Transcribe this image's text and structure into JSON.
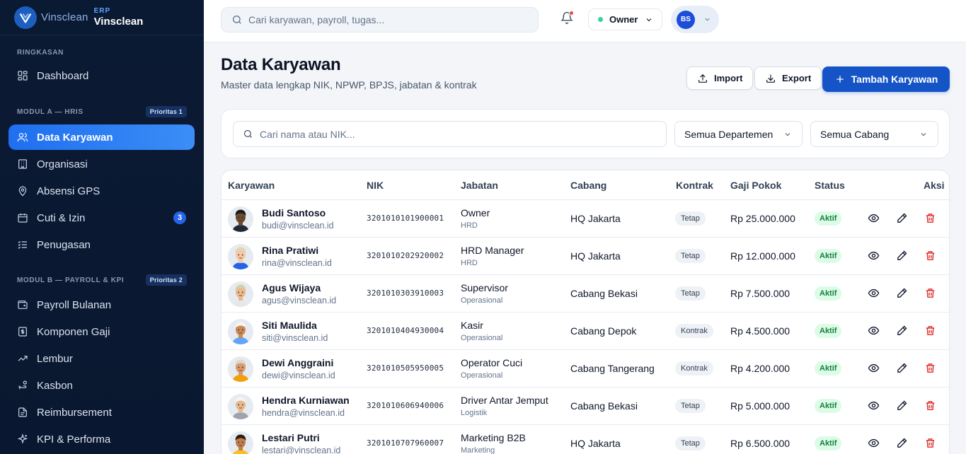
{
  "brand": {
    "logo_text": "Vinsclean",
    "erp": "ERP",
    "name": "Vinsclean"
  },
  "sidebar": {
    "sections": [
      {
        "label": "RINGKASAN",
        "badge": ""
      },
      {
        "label": "MODUL A — HRIS",
        "badge": "Prioritas 1"
      },
      {
        "label": "MODUL B — PAYROLL & KPI",
        "badge": "Prioritas 2"
      }
    ],
    "items": [
      {
        "label": "Dashboard",
        "icon": "grid-icon"
      },
      {
        "label": "Data Karyawan",
        "icon": "users-icon",
        "active": true
      },
      {
        "label": "Organisasi",
        "icon": "building-icon"
      },
      {
        "label": "Absensi GPS",
        "icon": "map-pin-icon"
      },
      {
        "label": "Cuti & Izin",
        "icon": "calendar-icon",
        "badge": "3"
      },
      {
        "label": "Penugasan",
        "icon": "list-check-icon"
      },
      {
        "label": "Payroll Bulanan",
        "icon": "wallet-icon"
      },
      {
        "label": "Komponen Gaji",
        "icon": "receipt-icon"
      },
      {
        "label": "Lembur",
        "icon": "trending-up-icon"
      },
      {
        "label": "Kasbon",
        "icon": "hand-coins-icon"
      },
      {
        "label": "Reimbursement",
        "icon": "file-text-icon"
      },
      {
        "label": "KPI & Performa",
        "icon": "sparkle-icon"
      }
    ]
  },
  "topbar": {
    "search_placeholder": "Cari karyawan, payroll, tugas...",
    "role": "Owner",
    "user_initials": "BS"
  },
  "page": {
    "title": "Data Karyawan",
    "subtitle": "Master data lengkap NIK, NPWP, BPJS, jabatan & kontrak",
    "import_label": "Import",
    "export_label": "Export",
    "add_label": "Tambah Karyawan"
  },
  "filters": {
    "search_placeholder": "Cari nama atau NIK...",
    "department": "Semua Departemen",
    "branch": "Semua Cabang"
  },
  "table": {
    "columns": [
      "Karyawan",
      "NIK",
      "Jabatan",
      "Cabang",
      "Kontrak",
      "Gaji Pokok",
      "Status",
      "Aksi"
    ],
    "rows": [
      {
        "name": "Budi Santoso",
        "email": "budi@vinsclean.id",
        "nik": "3201010101900001",
        "job": "Owner",
        "dept": "HRD",
        "branch": "HQ Jakarta",
        "contract": "Tetap",
        "salary": "Rp 25.000.000",
        "status": "Aktif",
        "skin": "#6b4a2f",
        "hair": "#1a1a1a",
        "shirt": "#1f2937"
      },
      {
        "name": "Rina Pratiwi",
        "email": "rina@vinsclean.id",
        "nik": "3201010202920002",
        "job": "HRD Manager",
        "dept": "HRD",
        "branch": "HQ Jakarta",
        "contract": "Tetap",
        "salary": "Rp 12.000.000",
        "status": "Aktif",
        "skin": "#f1c9a5",
        "hair": "#e8d3b0",
        "shirt": "#2563eb"
      },
      {
        "name": "Agus Wijaya",
        "email": "agus@vinsclean.id",
        "nik": "3201010303910003",
        "job": "Supervisor",
        "dept": "Operasional",
        "branch": "Cabang Bekasi",
        "contract": "Tetap",
        "salary": "Rp 7.500.000",
        "status": "Aktif",
        "skin": "#e9b98d",
        "hair": "#d8cfa8",
        "shirt": "#e5e7eb"
      },
      {
        "name": "Siti Maulida",
        "email": "siti@vinsclean.id",
        "nik": "3201010404930004",
        "job": "Kasir",
        "dept": "Operasional",
        "branch": "Cabang Depok",
        "contract": "Kontrak",
        "salary": "Rp 4.500.000",
        "status": "Aktif",
        "skin": "#c98a55",
        "hair": "#f5f5f4",
        "shirt": "#60a5fa"
      },
      {
        "name": "Dewi Anggraini",
        "email": "dewi@vinsclean.id",
        "nik": "3201010505950005",
        "job": "Operator Cuci",
        "dept": "Operasional",
        "branch": "Cabang Tangerang",
        "contract": "Kontrak",
        "salary": "Rp 4.200.000",
        "status": "Aktif",
        "skin": "#d79b6c",
        "hair": "#e2d6c4",
        "shirt": "#f59e0b"
      },
      {
        "name": "Hendra Kurniawan",
        "email": "hendra@vinsclean.id",
        "nik": "3201010606940006",
        "job": "Driver Antar Jemput",
        "dept": "Logistik",
        "branch": "Cabang Bekasi",
        "contract": "Tetap",
        "salary": "Rp 5.000.000",
        "status": "Aktif",
        "skin": "#e6b98e",
        "hair": "#f3f4f6",
        "shirt": "#9ca3af"
      },
      {
        "name": "Lestari Putri",
        "email": "lestari@vinsclean.id",
        "nik": "3201010707960007",
        "job": "Marketing B2B",
        "dept": "Marketing",
        "branch": "HQ Jakarta",
        "contract": "Tetap",
        "salary": "Rp 6.500.000",
        "status": "Aktif",
        "skin": "#c07d4c",
        "hair": "#2b1d14",
        "shirt": "#fbbf24"
      }
    ]
  },
  "colors": {
    "accent": "#1554c6",
    "sidebar_bg": "#0b1a33",
    "active_nav": "#2f7ff3",
    "status_green": "#15803d",
    "danger": "#dc2626"
  }
}
